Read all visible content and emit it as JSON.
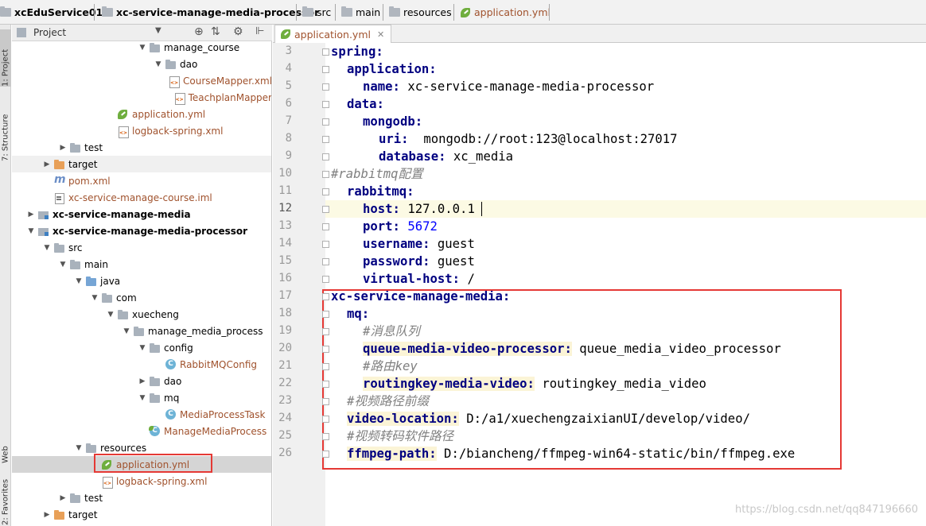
{
  "breadcrumb": {
    "items": [
      {
        "label": "xcEduService01",
        "icon": "module-folder-icon"
      },
      {
        "label": "xc-service-manage-media-processor",
        "icon": "module-folder-icon"
      },
      {
        "label": "src",
        "icon": "folder-icon"
      },
      {
        "label": "main",
        "icon": "folder-icon"
      },
      {
        "label": "resources",
        "icon": "folder-icon"
      },
      {
        "label": "application.yml",
        "icon": "yml-icon"
      }
    ]
  },
  "toolstrip": {
    "project_label": "1: Project",
    "structure_label": "7: Structure",
    "web_label": "Web",
    "favorites_label": "2: Favorites"
  },
  "project_panel": {
    "title": "Project",
    "tree": [
      {
        "label": "manage_course",
        "depth": 8,
        "icon": "folder",
        "arrow": "down"
      },
      {
        "label": "dao",
        "depth": 9,
        "icon": "folder",
        "arrow": "down"
      },
      {
        "label": "CourseMapper.xml",
        "depth": 10,
        "icon": "xml",
        "arrow": "none",
        "style": "orange"
      },
      {
        "label": "TeachplanMapper",
        "depth": 10,
        "icon": "xml",
        "arrow": "none",
        "style": "orange"
      },
      {
        "label": "application.yml",
        "depth": 6,
        "icon": "yml",
        "arrow": "none",
        "style": "orange"
      },
      {
        "label": "logback-spring.xml",
        "depth": 6,
        "icon": "xml",
        "arrow": "none",
        "style": "orange"
      },
      {
        "label": "test",
        "depth": 3,
        "icon": "folder",
        "arrow": "right"
      },
      {
        "label": "target",
        "depth": 2,
        "icon": "folder-orange",
        "arrow": "right",
        "band": true
      },
      {
        "label": "pom.xml",
        "depth": 2,
        "icon": "mvn",
        "arrow": "none",
        "style": "orange"
      },
      {
        "label": "xc-service-manage-course.iml",
        "depth": 2,
        "icon": "iml",
        "arrow": "none",
        "style": "orange"
      },
      {
        "label": "xc-service-manage-media",
        "depth": 1,
        "icon": "module",
        "arrow": "right",
        "style": "bold"
      },
      {
        "label": "xc-service-manage-media-processor",
        "depth": 1,
        "icon": "module",
        "arrow": "down",
        "style": "bold"
      },
      {
        "label": "src",
        "depth": 2,
        "icon": "folder",
        "arrow": "down"
      },
      {
        "label": "main",
        "depth": 3,
        "icon": "folder",
        "arrow": "down"
      },
      {
        "label": "java",
        "depth": 4,
        "icon": "folder-blue",
        "arrow": "down"
      },
      {
        "label": "com",
        "depth": 5,
        "icon": "folder",
        "arrow": "down"
      },
      {
        "label": "xuecheng",
        "depth": 6,
        "icon": "folder",
        "arrow": "down"
      },
      {
        "label": "manage_media_process",
        "depth": 7,
        "icon": "folder",
        "arrow": "down"
      },
      {
        "label": "config",
        "depth": 8,
        "icon": "folder",
        "arrow": "down"
      },
      {
        "label": "RabbitMQConfig",
        "depth": 9,
        "icon": "class",
        "arrow": "none",
        "style": "orange"
      },
      {
        "label": "dao",
        "depth": 8,
        "icon": "folder",
        "arrow": "right"
      },
      {
        "label": "mq",
        "depth": 8,
        "icon": "folder",
        "arrow": "down"
      },
      {
        "label": "MediaProcessTask",
        "depth": 9,
        "icon": "class",
        "arrow": "none",
        "style": "orange"
      },
      {
        "label": "ManageMediaProcess",
        "depth": 8,
        "icon": "springclass",
        "arrow": "none",
        "style": "orange"
      },
      {
        "label": "resources",
        "depth": 4,
        "icon": "folder-res",
        "arrow": "down"
      },
      {
        "label": "application.yml",
        "depth": 5,
        "icon": "yml",
        "arrow": "none",
        "style": "orange",
        "selected": true
      },
      {
        "label": "logback-spring.xml",
        "depth": 5,
        "icon": "xml",
        "arrow": "none",
        "style": "orange"
      },
      {
        "label": "test",
        "depth": 3,
        "icon": "folder",
        "arrow": "right"
      },
      {
        "label": "target",
        "depth": 2,
        "icon": "folder-orange",
        "arrow": "right"
      }
    ]
  },
  "editor": {
    "tab_label": "application.yml",
    "current_line": 12,
    "lines": [
      {
        "n": "3",
        "indent": 0,
        "key": "spring:",
        "value": ""
      },
      {
        "n": "4",
        "indent": 1,
        "key": "application:",
        "value": ""
      },
      {
        "n": "5",
        "indent": 2,
        "key": "name:",
        "value": " xc-service-manage-media-processor"
      },
      {
        "n": "6",
        "indent": 1,
        "key": "data:",
        "value": ""
      },
      {
        "n": "7",
        "indent": 2,
        "key": "mongodb:",
        "value": ""
      },
      {
        "n": "8",
        "indent": 3,
        "key": "uri:",
        "value": "  mongodb://root:123@localhost:27017"
      },
      {
        "n": "9",
        "indent": 3,
        "key": "database:",
        "value": " xc_media"
      },
      {
        "n": "10",
        "indent": 0,
        "comment": "#rabbitmq配置"
      },
      {
        "n": "11",
        "indent": 1,
        "key": "rabbitmq:",
        "value": ""
      },
      {
        "n": "12",
        "indent": 2,
        "key": "host:",
        "value": " 127.0.0.1"
      },
      {
        "n": "13",
        "indent": 2,
        "key": "port:",
        "value": " 5672",
        "numeric": true
      },
      {
        "n": "14",
        "indent": 2,
        "key": "username:",
        "value": " guest"
      },
      {
        "n": "15",
        "indent": 2,
        "key": "password:",
        "value": " guest"
      },
      {
        "n": "16",
        "indent": 2,
        "key": "virtual-host:",
        "value": " /"
      },
      {
        "n": "17",
        "indent": 0,
        "key": "xc-service-manage-media:",
        "value": ""
      },
      {
        "n": "18",
        "indent": 1,
        "key": "mq:",
        "value": ""
      },
      {
        "n": "19",
        "indent": 2,
        "comment": "#消息队列"
      },
      {
        "n": "20",
        "indent": 2,
        "key": "queue-media-video-processor:",
        "value": " queue_media_video_processor",
        "hl": true
      },
      {
        "n": "21",
        "indent": 2,
        "comment": "#路由key"
      },
      {
        "n": "22",
        "indent": 2,
        "key": "routingkey-media-video:",
        "value": " routingkey_media_video",
        "hl": true
      },
      {
        "n": "23",
        "indent": 1,
        "comment": "#视频路径前缀"
      },
      {
        "n": "24",
        "indent": 1,
        "key": "video-location:",
        "value": " D:/a1/xuechengzaixianUI/develop/video/",
        "hl": true
      },
      {
        "n": "25",
        "indent": 1,
        "comment": "#视频转码软件路径"
      },
      {
        "n": "26",
        "indent": 1,
        "key": "ffmpeg-path:",
        "value": " D:/biancheng/ffmpeg-win64-static/bin/ffmpeg.exe",
        "hl": true
      }
    ]
  },
  "watermark": "https://blog.csdn.net/qq847196660",
  "colors": {
    "highlight_box": "#e53935",
    "yaml_key": "#000080",
    "number": "#0000ff",
    "comment": "#808080"
  }
}
